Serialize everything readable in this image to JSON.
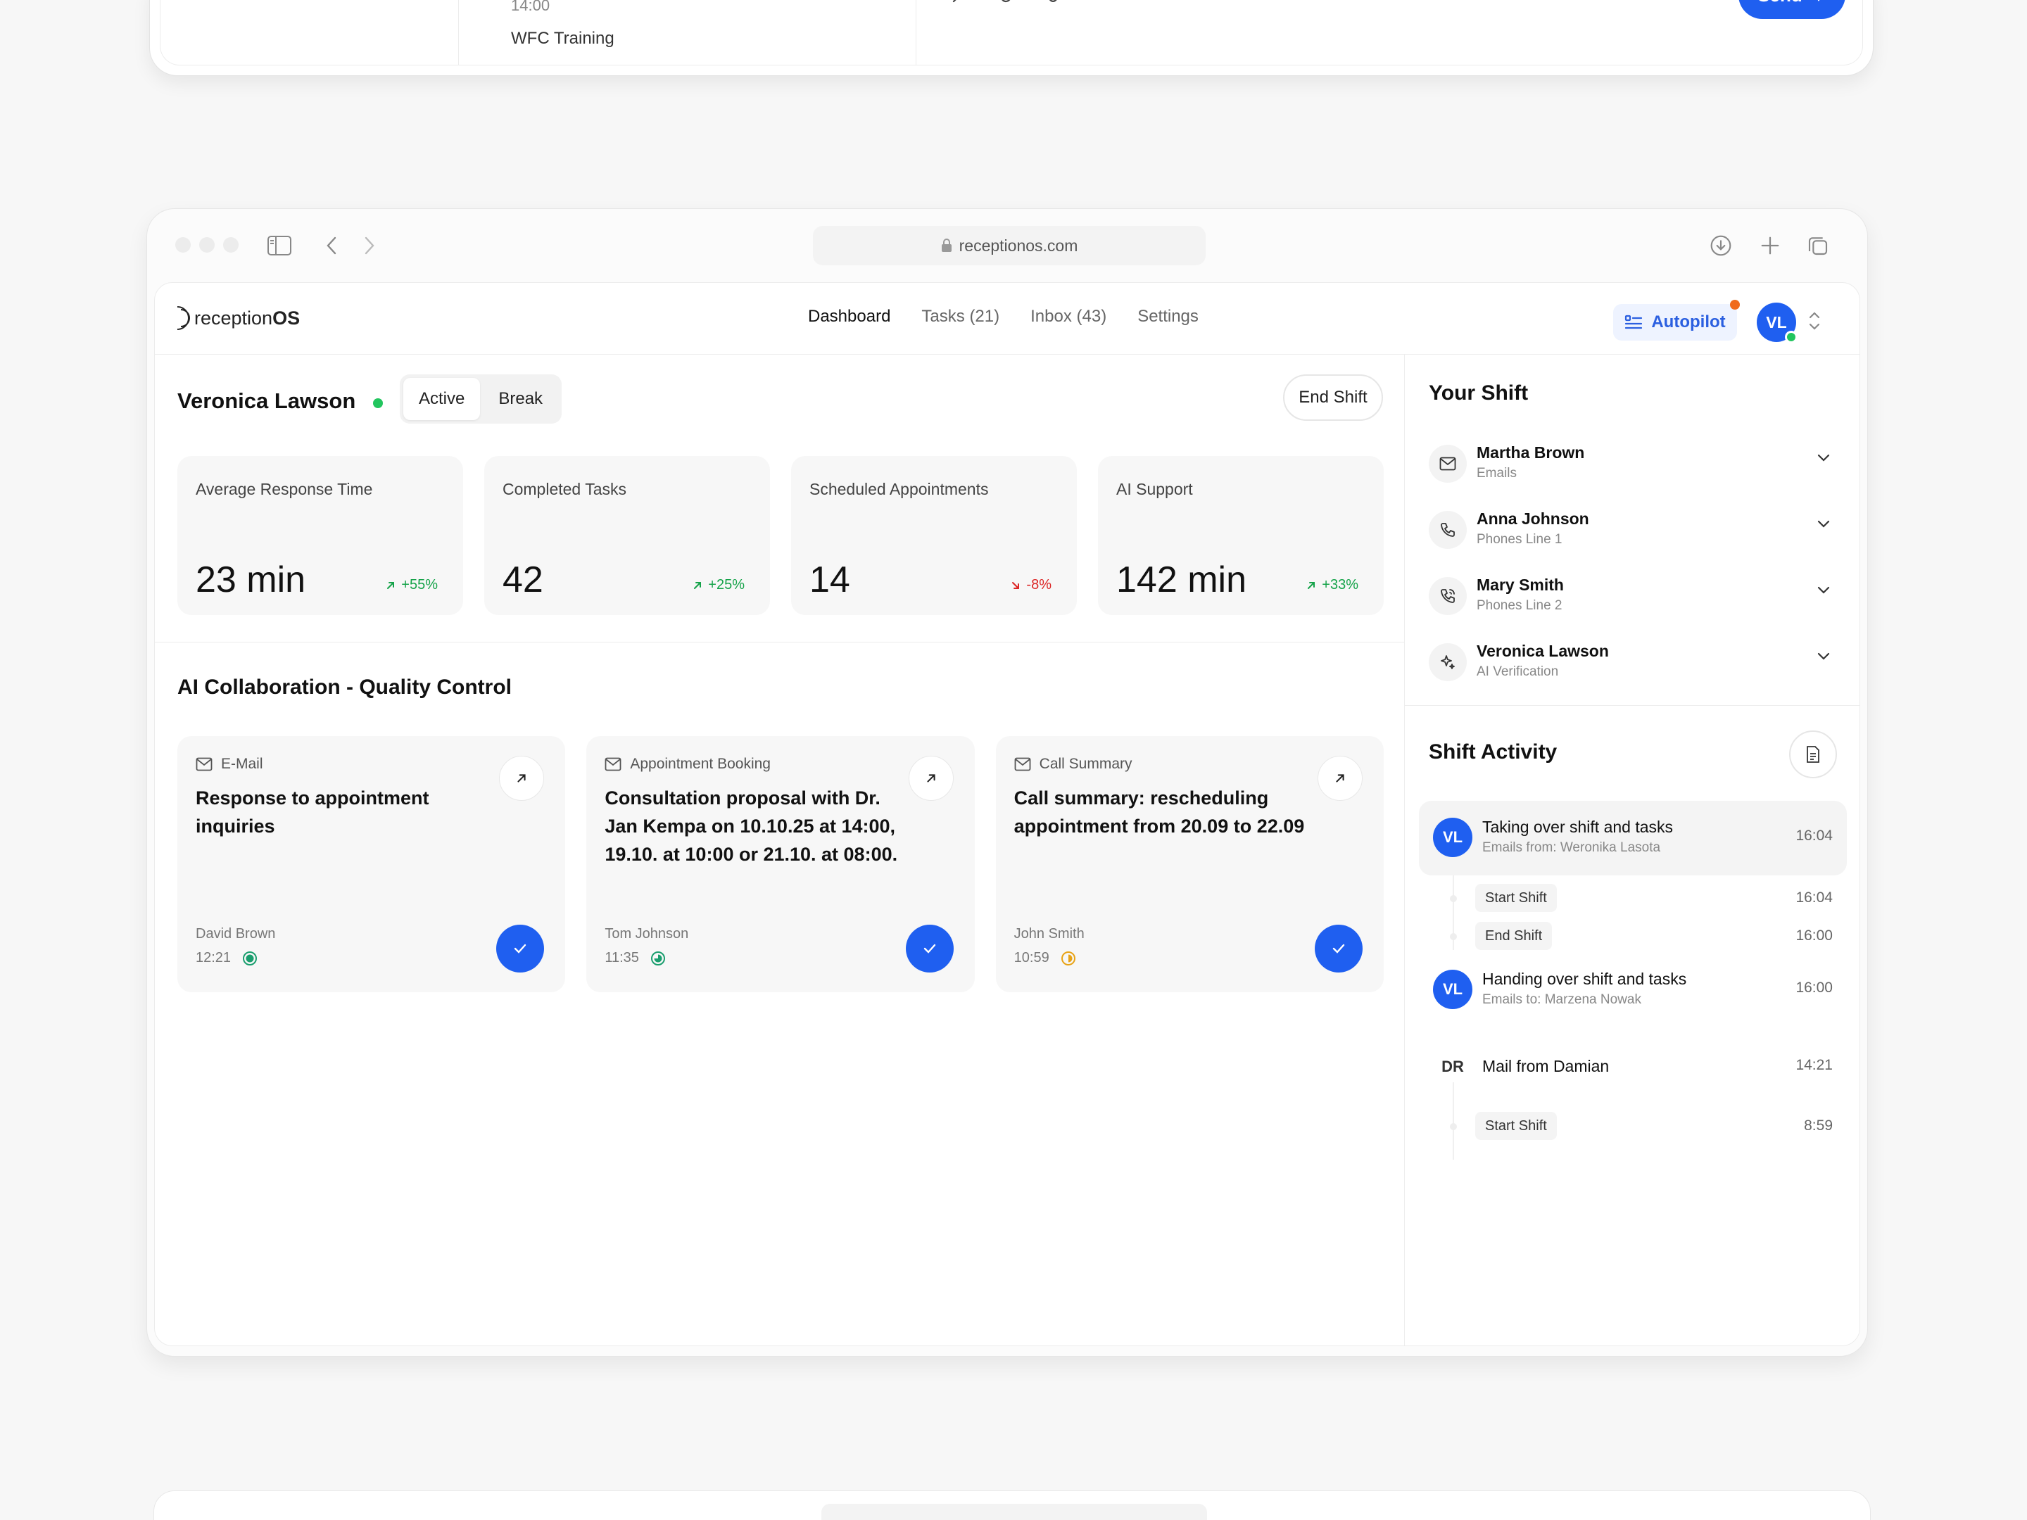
{
  "prev_window": {
    "time_text": "14:00",
    "item_text": "WFC Training",
    "tools": [
      "magic-wand-icon",
      "paperclip-icon",
      "link-icon"
    ],
    "send_label": "Send"
  },
  "browser": {
    "url": "receptionos.com"
  },
  "header": {
    "logo_prefix": "reception",
    "logo_suffix": "OS",
    "nav": [
      "Dashboard",
      "Tasks (21)",
      "Inbox (43)",
      "Settings"
    ],
    "active_nav": "Dashboard",
    "autopilot_label": "Autopilot",
    "user_initials": "VL"
  },
  "main": {
    "user_name": "Veronica Lawson",
    "status_options": [
      "Active",
      "Break"
    ],
    "status_selected": "Active",
    "end_shift_label": "End Shift",
    "stats": [
      {
        "label": "Average Response Time",
        "value": "23 min",
        "delta": "+55%",
        "trend": "up"
      },
      {
        "label": "Completed Tasks",
        "value": "42",
        "delta": "+25%",
        "trend": "up"
      },
      {
        "label": "Scheduled Appointments",
        "value": "14",
        "delta": "-8%",
        "trend": "down"
      },
      {
        "label": "AI Support",
        "value": "142 min",
        "delta": "+33%",
        "trend": "up"
      }
    ],
    "section_title": "AI Collaboration - Quality Control",
    "cards": [
      {
        "category": "E-Mail",
        "text": "Response to appointment inquiries",
        "author": "David Brown",
        "time": "12:21",
        "status": "green"
      },
      {
        "category": "Appointment Booking",
        "text": "Consultation proposal with Dr. Jan Kempa on 10.10.25 at 14:00, 19.10. at 10:00 or 21.10. at 08:00.",
        "author": "Tom Johnson",
        "time": "11:35",
        "status": "green"
      },
      {
        "category": "Call Summary",
        "text": "Call summary: rescheduling appointment from 20.09 to 22.09",
        "author": "John Smith",
        "time": "10:59",
        "status": "yellow"
      }
    ]
  },
  "side": {
    "shift_title": "Your Shift",
    "shift": [
      {
        "name": "Martha Brown",
        "role": "Emails",
        "icon": "mail-icon"
      },
      {
        "name": "Anna Johnson",
        "role": "Phones Line 1",
        "icon": "phone-icon"
      },
      {
        "name": "Mary Smith",
        "role": "Phones Line 2",
        "icon": "phone-call-icon"
      },
      {
        "name": "Veronica Lawson",
        "role": "AI Verification",
        "icon": "sparkle-icon"
      }
    ],
    "activity_title": "Shift Activity",
    "activity": {
      "a1": {
        "initials": "VL",
        "title": "Taking over shift and tasks",
        "sub": "Emails from: Weronika Lasota",
        "time": "16:04"
      },
      "a1_sub1": {
        "label": "Start Shift",
        "time": "16:04"
      },
      "a1_sub2": {
        "label": "End Shift",
        "time": "16:00"
      },
      "a2": {
        "initials": "VL",
        "title": "Handing over shift and tasks",
        "sub": "Emails to: Marzena Nowak",
        "time": "16:00"
      },
      "a3": {
        "initials": "DR",
        "title": "Mail from Damian",
        "time": "14:21"
      },
      "a3_sub1": {
        "label": "Start Shift",
        "time": "8:59"
      }
    }
  },
  "colors": {
    "accent": "#1f5ff0",
    "positive": "#16a34a",
    "negative": "#dc2626",
    "notification": "#f06a1d"
  }
}
